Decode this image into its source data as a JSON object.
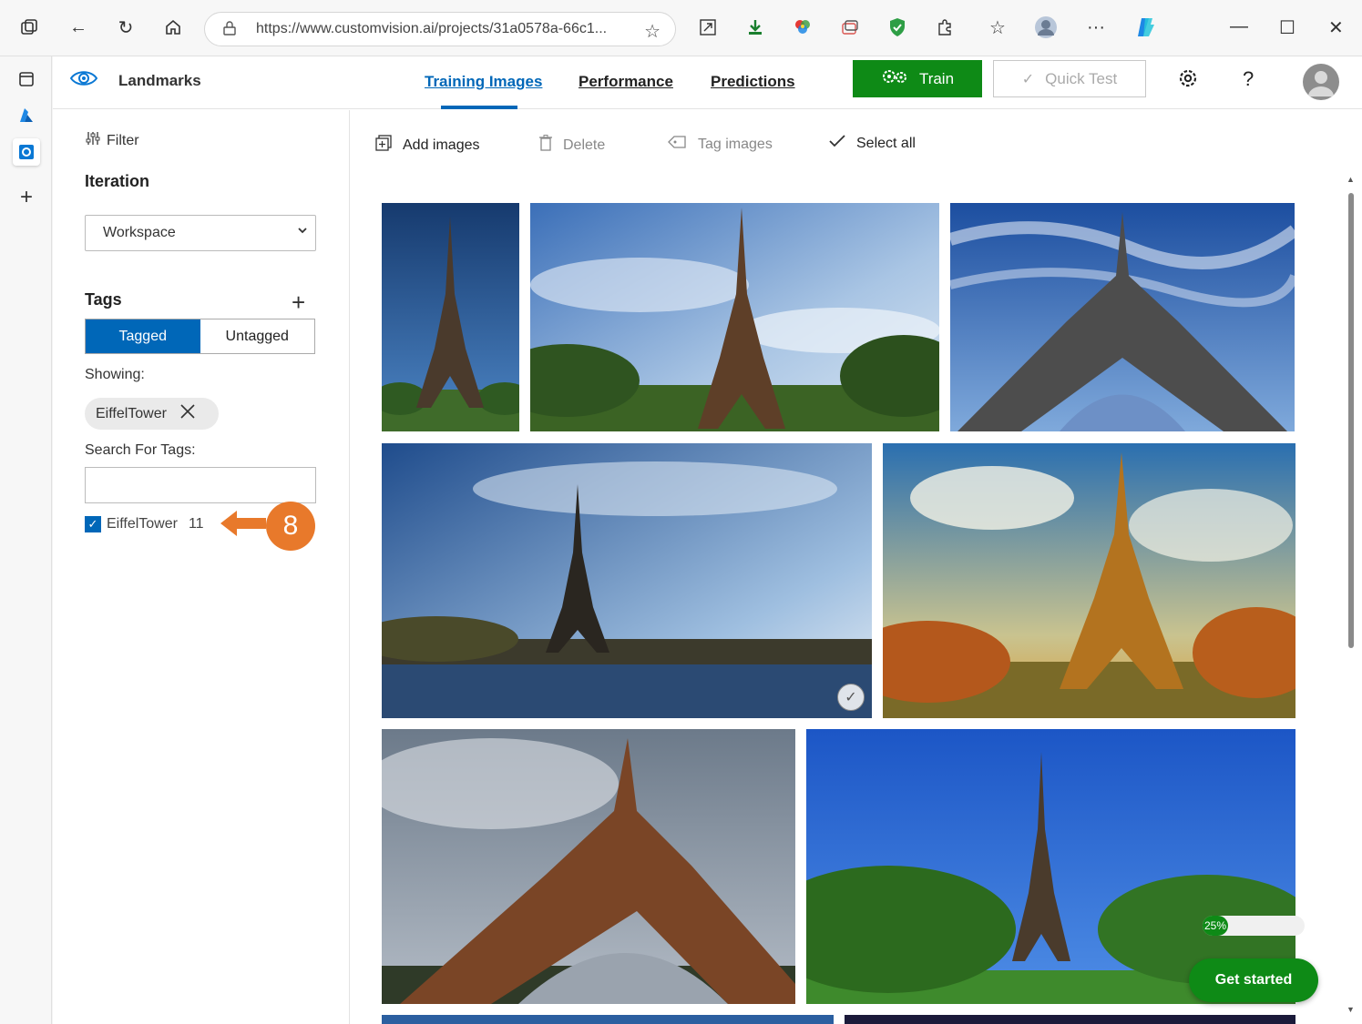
{
  "browser": {
    "url": "https://www.customvision.ai/projects/31a0578a-66c1...",
    "icons": [
      "workspaces-icon",
      "back-icon",
      "refresh-icon",
      "home-icon",
      "lock-icon",
      "favorite-star-icon",
      "expand-icon",
      "download-icon",
      "color-wheel-icon",
      "collections-icon",
      "shield-icon",
      "extensions-icon",
      "favorites-icon",
      "profile-icon",
      "more-icon",
      "copilot-icon",
      "minimize-icon",
      "maximize-icon",
      "close-icon"
    ]
  },
  "edge_sidebar": {
    "icons": [
      "tab-actions-icon",
      "azure-icon",
      "custom-vision-icon",
      "add-icon"
    ]
  },
  "app": {
    "project_name": "Landmarks",
    "tabs": [
      {
        "label": "Training Images",
        "active": true
      },
      {
        "label": "Performance",
        "active": false
      },
      {
        "label": "Predictions",
        "active": false
      }
    ],
    "train_label": "Train",
    "quick_test_label": "Quick Test",
    "help_label": "?"
  },
  "left_panel": {
    "filter_label": "Filter",
    "iteration_heading": "Iteration",
    "iteration_value": "Workspace",
    "tags_heading": "Tags",
    "tagged_label": "Tagged",
    "untagged_label": "Untagged",
    "showing_label": "Showing:",
    "active_chip": "EiffelTower",
    "search_label": "Search For Tags:",
    "search_value": "",
    "tag_list": [
      {
        "name": "EiffelTower",
        "count": "11",
        "checked": true
      }
    ],
    "callout_number": "8"
  },
  "toolbar": {
    "add_images": "Add images",
    "delete": "Delete",
    "tag_images": "Tag images",
    "select_all": "Select all"
  },
  "images": {
    "count_visible": 9,
    "selected_index": 3
  },
  "progress": {
    "percent_label": "25%",
    "value": 0.25
  },
  "get_started_label": "Get started",
  "colors": {
    "accent_blue": "#0067b8",
    "train_green": "#0e8a16",
    "callout_orange": "#e8792b"
  }
}
